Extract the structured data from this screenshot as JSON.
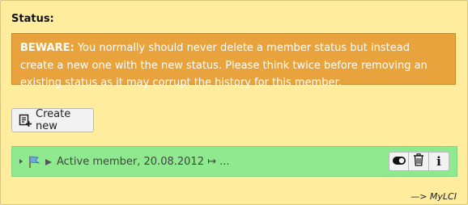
{
  "status": {
    "title": "Status:",
    "warning_label": "BEWARE:",
    "warning_text": " You normally should never delete a member status but instead create a new one with the new status. Please think twice before removing an existing status as it may corrupt the history for this member.",
    "create_button": "Create new"
  },
  "row": {
    "label": "Active member, 20.08.2012 ↦ ...",
    "background": "#8fea8f",
    "actions": [
      "toggle-icon",
      "trash-icon",
      "info-icon"
    ],
    "info_glyph": "i"
  },
  "footer": {
    "link": "—> MyLCI"
  },
  "colors": {
    "panel": "#ffec9c",
    "warning": "#e8a33d"
  }
}
